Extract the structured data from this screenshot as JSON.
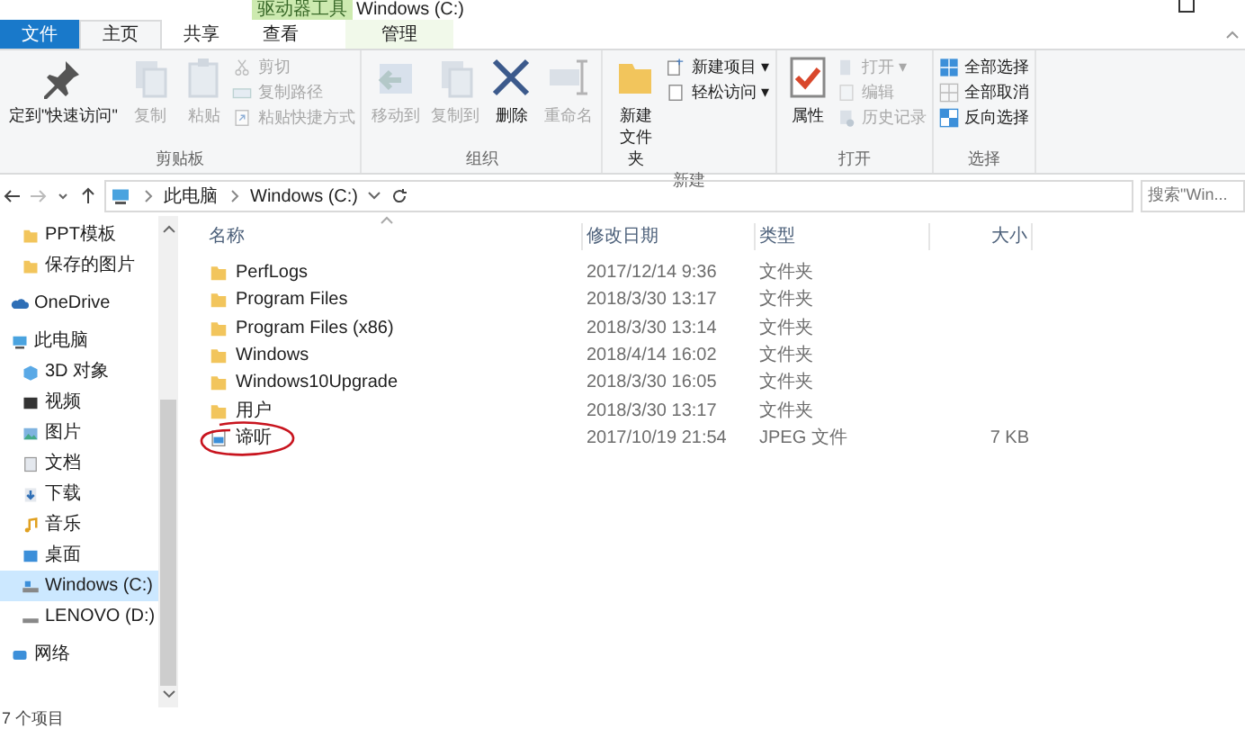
{
  "title_bar": {
    "context_tab": "驱动器工具",
    "title": "Windows (C:)"
  },
  "file_menu_button": "文件",
  "tabs": [
    {
      "label": "主页",
      "kind": "tab",
      "selected": true
    },
    {
      "label": "共享",
      "kind": "tab",
      "selected": false
    },
    {
      "label": "查看",
      "kind": "tab",
      "selected": false
    },
    {
      "label": "管理",
      "kind": "context",
      "selected": false
    }
  ],
  "ribbon": [
    {
      "label": "剪贴板",
      "items": [
        {
          "label": "定到\"快速访问\"",
          "kind": "large",
          "disabled": false
        },
        {
          "label": "复制",
          "kind": "large",
          "disabled": true
        },
        {
          "label": "粘贴",
          "kind": "large",
          "disabled": true
        },
        {
          "kind": "stack",
          "items": [
            {
              "label": "剪切",
              "disabled": true
            },
            {
              "label": "复制路径",
              "disabled": true
            },
            {
              "label": "粘贴快捷方式",
              "disabled": true
            }
          ]
        }
      ]
    },
    {
      "label": "组织",
      "items": [
        {
          "label": "移动到",
          "kind": "large",
          "disabled": true
        },
        {
          "label": "复制到",
          "kind": "large",
          "disabled": true
        },
        {
          "label": "删除",
          "kind": "large",
          "disabled": false
        },
        {
          "label": "重命名",
          "kind": "large",
          "disabled": true
        }
      ]
    },
    {
      "label": "新建",
      "items": [
        {
          "label": "新建文件夹",
          "kind": "large",
          "disabled": false
        },
        {
          "kind": "stack",
          "items": [
            {
              "label": "新建项目 ▾",
              "disabled": false
            },
            {
              "label": "轻松访问 ▾",
              "disabled": false
            }
          ]
        }
      ]
    },
    {
      "label": "打开",
      "items": [
        {
          "label": "属性",
          "kind": "large",
          "disabled": false
        },
        {
          "kind": "stack",
          "items": [
            {
              "label": "打开 ▾",
              "disabled": true
            },
            {
              "label": "编辑",
              "disabled": true
            },
            {
              "label": "历史记录",
              "disabled": true
            }
          ]
        }
      ]
    },
    {
      "label": "选择",
      "items": [
        {
          "kind": "stack",
          "items": [
            {
              "label": "全部选择",
              "disabled": false
            },
            {
              "label": "全部取消",
              "disabled": false
            },
            {
              "label": "反向选择",
              "disabled": false
            }
          ]
        }
      ]
    }
  ],
  "address": {
    "path": [
      "此电脑",
      "Windows (C:)"
    ],
    "search_placeholder": "搜索\"Win..."
  },
  "quick_access_items": [
    {
      "label": "PPT模板",
      "selected": false
    },
    {
      "label": "保存的图片",
      "selected": false
    }
  ],
  "sidebar": [
    {
      "label": "OneDrive",
      "selected": false
    },
    {
      "label": "此电脑",
      "selected": false,
      "children": [
        {
          "label": "3D 对象",
          "selected": false
        },
        {
          "label": "视频",
          "selected": false
        },
        {
          "label": "图片",
          "selected": false
        },
        {
          "label": "文档",
          "selected": false
        },
        {
          "label": "下载",
          "selected": false
        },
        {
          "label": "音乐",
          "selected": false
        },
        {
          "label": "桌面",
          "selected": false
        },
        {
          "label": "Windows (C:)",
          "selected": true
        },
        {
          "label": "LENOVO (D:)",
          "selected": false
        }
      ]
    },
    {
      "label": "网络",
      "selected": false
    }
  ],
  "table": {
    "columns": [
      "名称",
      "修改日期",
      "类型",
      "大小"
    ],
    "rows": [
      {
        "name": "PerfLogs",
        "kind": "folder",
        "date": "2017/12/14 9:36",
        "type": "文件夹",
        "circled": false
      },
      {
        "name": "Program Files",
        "kind": "folder",
        "date": "2018/3/30 13:17",
        "type": "文件夹",
        "circled": false
      },
      {
        "name": "Program Files (x86)",
        "kind": "folder",
        "date": "2018/3/30 13:14",
        "type": "文件夹",
        "circled": false
      },
      {
        "name": "Windows",
        "kind": "folder",
        "date": "2018/4/14 16:02",
        "type": "文件夹",
        "circled": false
      },
      {
        "name": "Windows10Upgrade",
        "kind": "folder",
        "date": "2018/3/30 16:05",
        "type": "文件夹",
        "circled": false
      },
      {
        "name": "用户",
        "kind": "folder",
        "date": "2018/3/30 13:17",
        "type": "文件夹",
        "circled": false
      },
      {
        "name": "谛听",
        "kind": "image",
        "date": "2017/10/19 21:54",
        "type": "JPEG 文件",
        "size": "7 KB",
        "circled": true
      }
    ]
  },
  "status_bar": "7 个项目"
}
